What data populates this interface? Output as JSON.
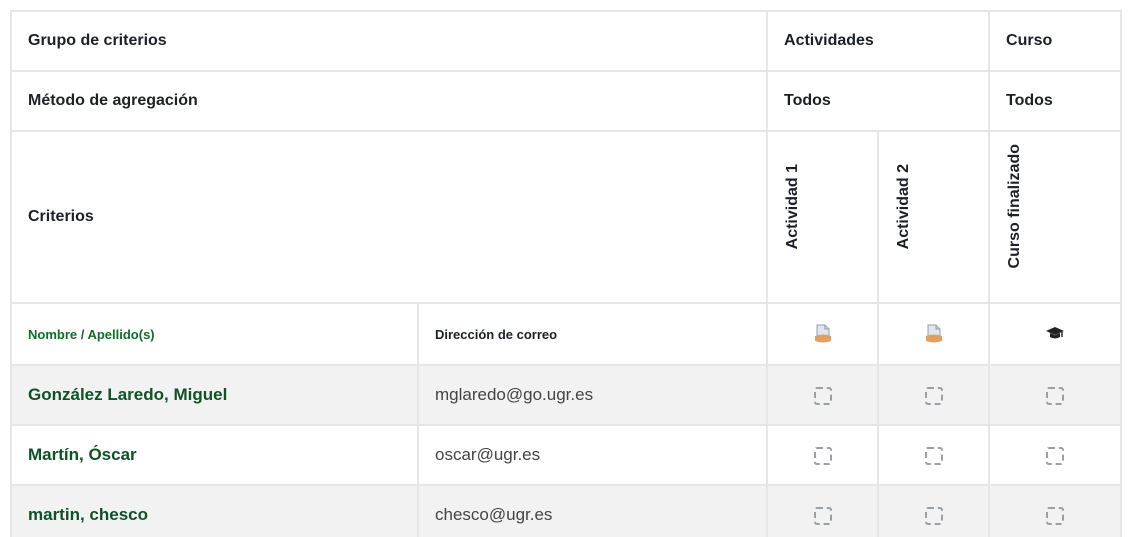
{
  "header_rows": {
    "group_label": "Grupo de criterios",
    "group_activities": "Actividades",
    "group_course": "Curso",
    "method_label": "Método de agregación",
    "method_activities": "Todos",
    "method_course": "Todos",
    "criteria_label": "Criterios",
    "criteria_items": [
      "Actividad 1",
      "Actividad 2",
      "Curso finalizado"
    ]
  },
  "columns": {
    "name": "Nombre / Apellido(s)",
    "email": "Dirección de correo"
  },
  "icons": {
    "activity": "activity-page-icon",
    "course": "graduation-cap-icon"
  },
  "colors": {
    "user_link": "#0f5226",
    "border": "#e6e6e6",
    "alt_row": "#f2f2f2"
  },
  "users": [
    {
      "name": "González Laredo, Miguel",
      "email": "mglaredo@go.ugr.es"
    },
    {
      "name": "Martín, Óscar",
      "email": "oscar@ugr.es"
    },
    {
      "name": "martin, chesco",
      "email": "chesco@ugr.es"
    }
  ]
}
